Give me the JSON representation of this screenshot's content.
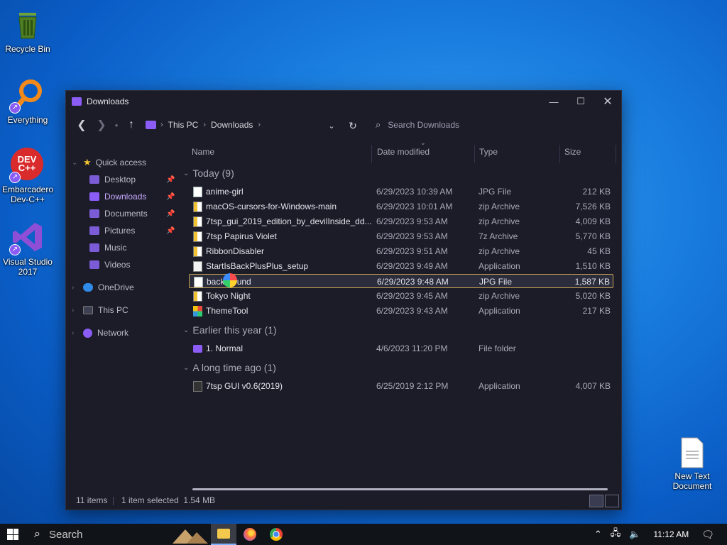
{
  "desktop": {
    "icons": [
      {
        "label": "Recycle Bin"
      },
      {
        "label": "Everything"
      },
      {
        "label": "Embarcadero Dev-C++",
        "logo_text": "DEV C++"
      },
      {
        "label": "Visual Studio 2017"
      },
      {
        "label": "New Text Document"
      }
    ]
  },
  "window": {
    "title": "Downloads",
    "breadcrumb": [
      "This PC",
      "Downloads"
    ],
    "search_placeholder": "Search Downloads",
    "sidebar": [
      {
        "label": "Quick access"
      },
      {
        "label": "Desktop"
      },
      {
        "label": "Downloads"
      },
      {
        "label": "Documents"
      },
      {
        "label": "Pictures"
      },
      {
        "label": "Music"
      },
      {
        "label": "Videos"
      },
      {
        "label": "OneDrive"
      },
      {
        "label": "This PC"
      },
      {
        "label": "Network"
      }
    ],
    "columns": {
      "name": "Name",
      "date": "Date modified",
      "type": "Type",
      "size": "Size"
    },
    "groups": [
      {
        "title": "Today (9)"
      },
      {
        "title": "Earlier this year (1)"
      },
      {
        "title": "A long time ago (1)"
      }
    ],
    "files": [
      {
        "name": "anime-girl",
        "date": "6/29/2023 10:39 AM",
        "type": "JPG File",
        "size": "212 KB"
      },
      {
        "name": "macOS-cursors-for-Windows-main",
        "date": "6/29/2023 10:01 AM",
        "type": "zip Archive",
        "size": "7,526 KB"
      },
      {
        "name": "7tsp_gui_2019_edition_by_devilInside_dd...",
        "date": "6/29/2023 9:53 AM",
        "type": "zip Archive",
        "size": "4,009 KB"
      },
      {
        "name": "7tsp Papirus Violet",
        "date": "6/29/2023 9:53 AM",
        "type": "7z Archive",
        "size": "5,770 KB"
      },
      {
        "name": "RibbonDisabler",
        "date": "6/29/2023 9:51 AM",
        "type": "zip Archive",
        "size": "45 KB"
      },
      {
        "name": "StartIsBackPlusPlus_setup",
        "date": "6/29/2023 9:49 AM",
        "type": "Application",
        "size": "1,510 KB"
      },
      {
        "name": "background",
        "date": "6/29/2023 9:48 AM",
        "type": "JPG File",
        "size": "1,587 KB"
      },
      {
        "name": "Tokyo Night",
        "date": "6/29/2023 9:45 AM",
        "type": "zip Archive",
        "size": "5,020 KB"
      },
      {
        "name": "ThemeTool",
        "date": "6/29/2023 9:43 AM",
        "type": "Application",
        "size": "217 KB"
      },
      {
        "name": "1. Normal",
        "date": "4/6/2023 11:20 PM",
        "type": "File folder",
        "size": ""
      },
      {
        "name": "7tsp GUI v0.6(2019)",
        "date": "6/25/2019 2:12 PM",
        "type": "Application",
        "size": "4,007 KB"
      }
    ],
    "status": {
      "items": "11 items",
      "selected": "1 item selected  1.54 MB"
    }
  },
  "taskbar": {
    "search_label": "Search",
    "time": "11:12 AM"
  },
  "colors": {
    "accent": "#8b5cf6",
    "window_bg": "#1b1c27",
    "selection_border": "#c6a353"
  }
}
